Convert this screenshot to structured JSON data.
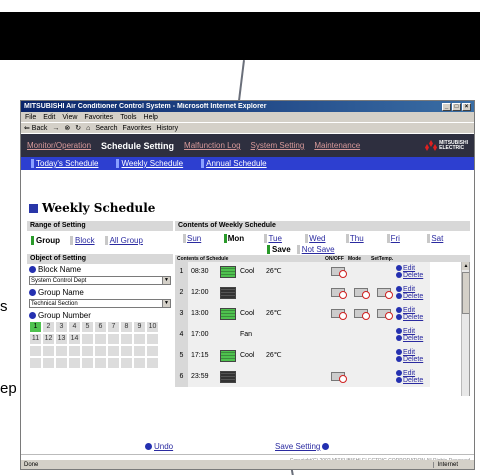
{
  "callout": {
    "text": ""
  },
  "edge_text": {
    "s": "s",
    "ep": "ep"
  },
  "window": {
    "title": "MITSUBISHI Air Conditioner Control System - Microsoft Internet Explorer",
    "menu": [
      "File",
      "Edit",
      "View",
      "Favorites",
      "Tools",
      "Help"
    ],
    "toolbar": {
      "back": "⇐ Back",
      "search": "Search",
      "favorites": "Favorites",
      "history": "History"
    }
  },
  "topnav": {
    "monitor": "Monitor/Operation",
    "active": "Schedule Setting",
    "malfunction": "Malfunction Log",
    "system": "System Setting",
    "maintenance": "Maintenance",
    "logo_line1": "MITSUBISHI",
    "logo_line2": "ELECTRIC"
  },
  "subnav": [
    "Today's Schedule",
    "Weekly Schedule",
    "Annual Schedule"
  ],
  "page": {
    "title": "Weekly Schedule"
  },
  "left": {
    "range_header": "Range of Setting",
    "tabs": {
      "group": "Group",
      "block": "Block",
      "all": "All Group"
    },
    "object_header": "Object of Setting",
    "block_label": "Block Name",
    "block_value": "System Control Dept",
    "group_label": "Group Name",
    "group_value": "Technical Section",
    "group_number_label": "Group Number",
    "numbers": [
      "1",
      "2",
      "3",
      "4",
      "5",
      "6",
      "7",
      "8",
      "9",
      "10",
      "11",
      "12",
      "13",
      "14",
      "",
      "",
      "",
      "",
      "",
      "",
      "",
      "",
      "",
      "",
      "",
      "",
      "",
      "",
      "",
      "",
      "",
      "",
      "",
      "",
      "",
      "",
      "",
      "",
      "",
      ""
    ]
  },
  "right": {
    "header": "Contents of Weekly Schedule",
    "days": [
      "Sun",
      "Mon",
      "Tue",
      "Wed",
      "Thu",
      "Fri",
      "Sat"
    ],
    "save_label": "Save",
    "not_save_label": "Not Save",
    "cols": {
      "contents": "Contents of Schedule",
      "onoff": "ON/OFF",
      "mode": "Mode",
      "settemp": "SetTemp."
    },
    "rows": [
      {
        "num": "1",
        "time": "08:30",
        "unit": "on",
        "mode": "Cool",
        "temp": "26℃",
        "edit": "Edit",
        "del": "Delete"
      },
      {
        "num": "2",
        "time": "12:00",
        "unit": "off",
        "mode": "",
        "temp": "",
        "edit": "Edit",
        "del": "Delete"
      },
      {
        "num": "3",
        "time": "13:00",
        "unit": "on",
        "mode": "Cool",
        "temp": "26℃",
        "edit": "Edit",
        "del": "Delete"
      },
      {
        "num": "4",
        "time": "17:00",
        "unit": "",
        "mode": "Fan",
        "temp": "",
        "edit": "Edit",
        "del": "Delete"
      },
      {
        "num": "5",
        "time": "17:15",
        "unit": "on",
        "mode": "Cool",
        "temp": "26℃",
        "edit": "Edit",
        "del": "Delete"
      },
      {
        "num": "6",
        "time": "23:59",
        "unit": "off",
        "mode": "",
        "temp": "",
        "edit": "Edit",
        "del": "Delete"
      }
    ]
  },
  "footer": {
    "undo": "Undo",
    "save_setting": "Save Setting",
    "copyright": "Copyright(C) 2002 MITSUBISHI ELECTRIC CORPORATION All Rights Reserved"
  },
  "status": {
    "left": "Done",
    "zone": "Internet"
  },
  "colors": {
    "nav_bg": "#2e2f3f",
    "subnav_bg": "#2d3fd0",
    "active_green": "#2a9a2a",
    "link_blue": "#2a2aa0"
  }
}
